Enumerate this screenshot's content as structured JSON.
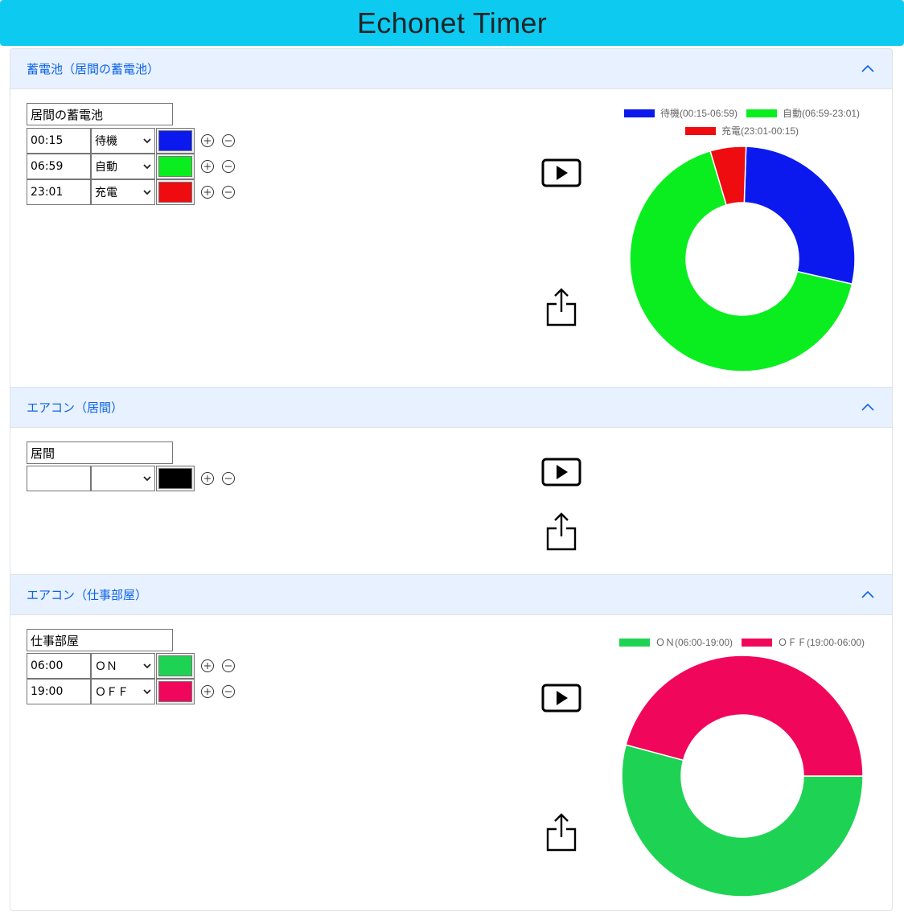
{
  "app": {
    "title": "Echonet Timer"
  },
  "sections": [
    {
      "header": "蓄電池（居間の蓄電池）",
      "name_value": "居間の蓄電池",
      "rows": [
        {
          "time": "00:15",
          "mode": "待機",
          "color": "#0c19ee"
        },
        {
          "time": "06:59",
          "mode": "自動",
          "color": "#0aee1f"
        },
        {
          "time": "23:01",
          "mode": "充電",
          "color": "#ee0c11"
        }
      ],
      "chart_data": {
        "type": "pie",
        "categories": [
          "待機(00:15-06:59)",
          "自動(06:59-23:01)",
          "充電(23:01-00:15)"
        ],
        "values": [
          6.73,
          16.03,
          1.23
        ],
        "colors": [
          "#0c19ee",
          "#0aee1f",
          "#ee0c11"
        ],
        "legend": "top"
      }
    },
    {
      "header": "エアコン（居間）",
      "name_value": "居間",
      "rows": [
        {
          "time": "",
          "mode": "",
          "color": "#000000"
        }
      ]
    },
    {
      "header": "エアコン（仕事部屋）",
      "name_value": "仕事部屋",
      "rows": [
        {
          "time": "06:00",
          "mode": "ＯＮ",
          "color": "#1ed354"
        },
        {
          "time": "19:00",
          "mode": "ＯＦＦ",
          "color": "#f0075c"
        }
      ],
      "chart_data": {
        "type": "pie",
        "categories": [
          "ＯＮ(06:00-19:00)",
          "ＯＦＦ(19:00-06:00)"
        ],
        "values": [
          13,
          11
        ],
        "colors": [
          "#1ed354",
          "#f0075c"
        ],
        "legend": "top"
      }
    }
  ]
}
